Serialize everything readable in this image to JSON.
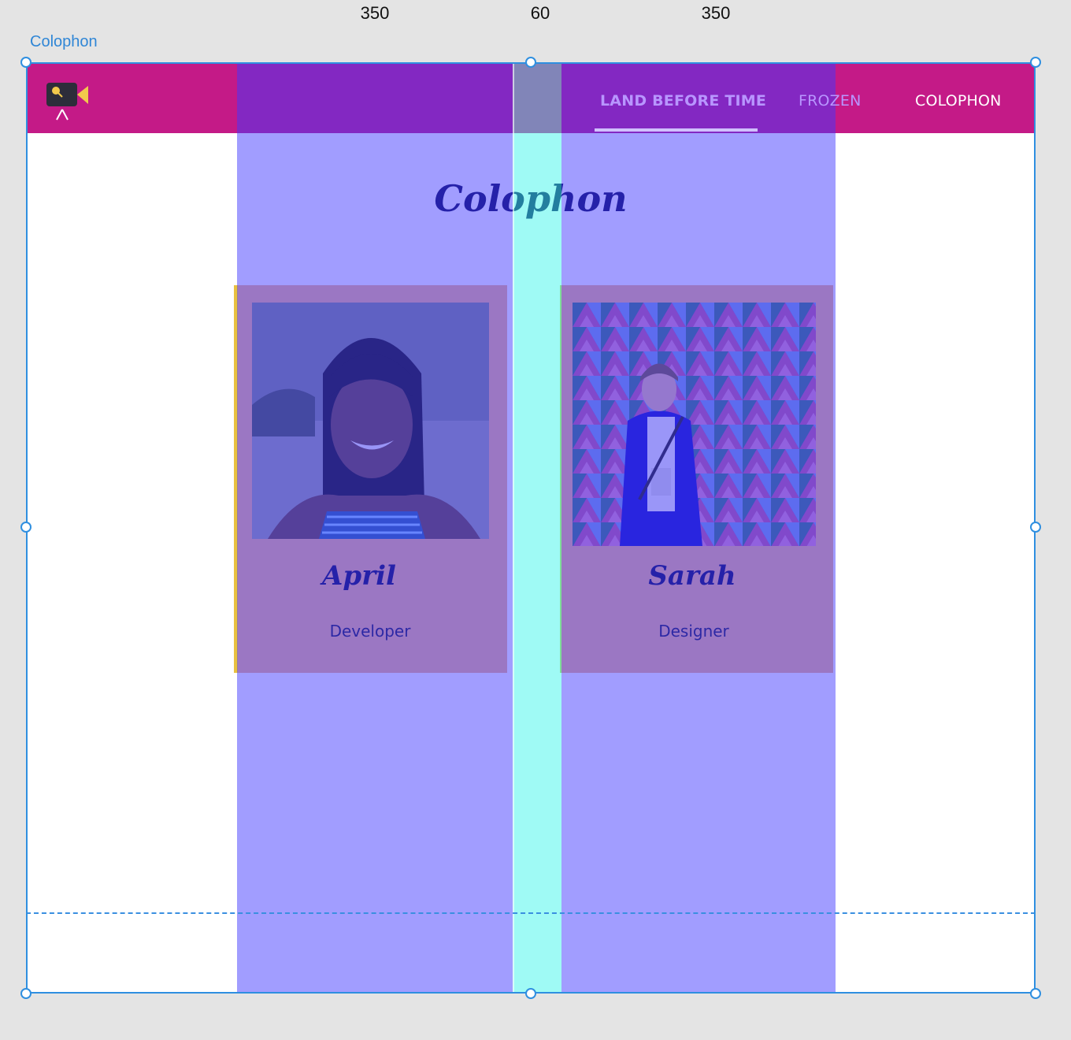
{
  "artboard": {
    "label": "Colophon"
  },
  "measurements": {
    "column_left": "350",
    "gutter": "60",
    "column_right": "350"
  },
  "nav": {
    "logo_icon": "camera-logo-icon",
    "items": [
      {
        "label": "LAND BEFORE TIME",
        "active": true
      },
      {
        "label": "FROZEN",
        "active": false
      },
      {
        "label": "COLOPHON",
        "active": false
      }
    ]
  },
  "page": {
    "title": "Colophon"
  },
  "team": [
    {
      "name": "April",
      "role": "Developer"
    },
    {
      "name": "Sarah",
      "role": "Designer"
    }
  ],
  "colors": {
    "navbar": "#c41a87",
    "grid_column": "#4038ff",
    "gutter": "#3cf5eb",
    "card": "#f4b48a",
    "title": "#0c0c56",
    "selection": "#2f8fe0"
  }
}
